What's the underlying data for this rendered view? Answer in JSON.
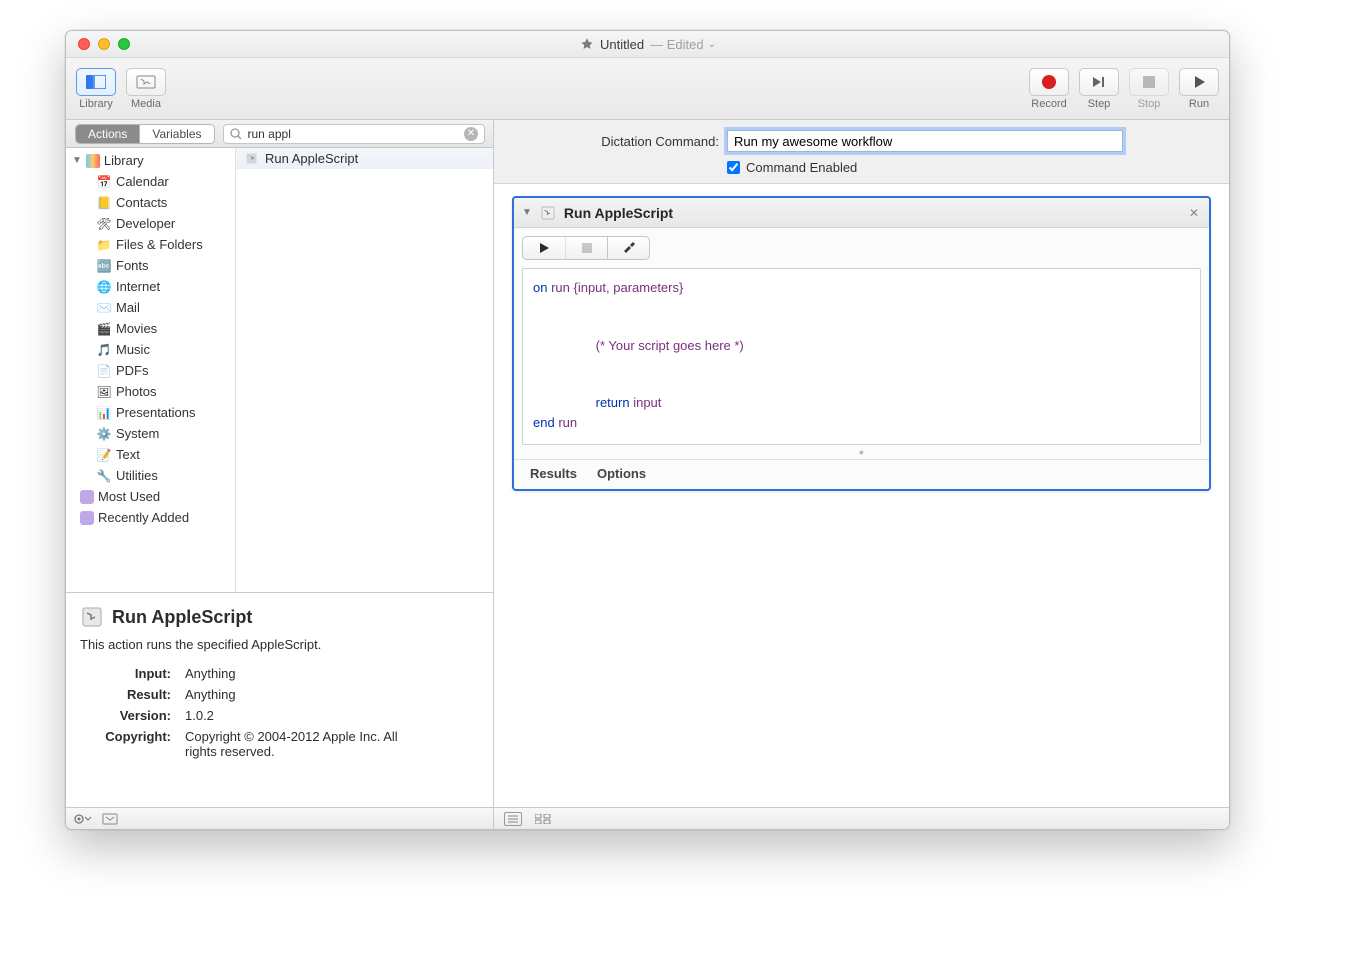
{
  "title": {
    "filename": "Untitled",
    "state": "Edited"
  },
  "toolbar": {
    "library": "Library",
    "media": "Media",
    "record": "Record",
    "step": "Step",
    "stop": "Stop",
    "run": "Run"
  },
  "tabs": {
    "actions": "Actions",
    "variables": "Variables"
  },
  "search": {
    "value": "run appl",
    "placeholder": "Search"
  },
  "library": {
    "root": "Library",
    "items": [
      {
        "icon": "📅",
        "label": "Calendar"
      },
      {
        "icon": "📒",
        "label": "Contacts"
      },
      {
        "icon": "🛠",
        "label": "Developer"
      },
      {
        "icon": "📁",
        "label": "Files & Folders"
      },
      {
        "icon": "🔤",
        "label": "Fonts"
      },
      {
        "icon": "🌐",
        "label": "Internet"
      },
      {
        "icon": "✉️",
        "label": "Mail"
      },
      {
        "icon": "🎬",
        "label": "Movies"
      },
      {
        "icon": "🎵",
        "label": "Music"
      },
      {
        "icon": "📄",
        "label": "PDFs"
      },
      {
        "icon": "🖼",
        "label": "Photos"
      },
      {
        "icon": "📊",
        "label": "Presentations"
      },
      {
        "icon": "⚙️",
        "label": "System"
      },
      {
        "icon": "📝",
        "label": "Text"
      },
      {
        "icon": "🔧",
        "label": "Utilities"
      }
    ],
    "most_used": "Most Used",
    "recently_added": "Recently Added"
  },
  "results": [
    {
      "label": "Run AppleScript"
    }
  ],
  "description": {
    "title": "Run AppleScript",
    "summary": "This action runs the specified AppleScript.",
    "input_label": "Input:",
    "input": "Anything",
    "result_label": "Result:",
    "result": "Anything",
    "version_label": "Version:",
    "version": "1.0.2",
    "copyright_label": "Copyright:",
    "copyright": "Copyright © 2004-2012 Apple Inc.  All rights reserved."
  },
  "dictation": {
    "label": "Dictation Command:",
    "value": "Run my awesome workflow",
    "checkbox": "Command Enabled",
    "checked": true
  },
  "action": {
    "title": "Run AppleScript",
    "script": {
      "line1a": "on",
      "line1b": " run {input, parameters}",
      "line2": "\t(* Your script goes here *)",
      "line3a": "\t",
      "line3b": "return",
      "line3c": " input",
      "line4a": "end",
      "line4b": " run"
    },
    "results": "Results",
    "options": "Options"
  }
}
